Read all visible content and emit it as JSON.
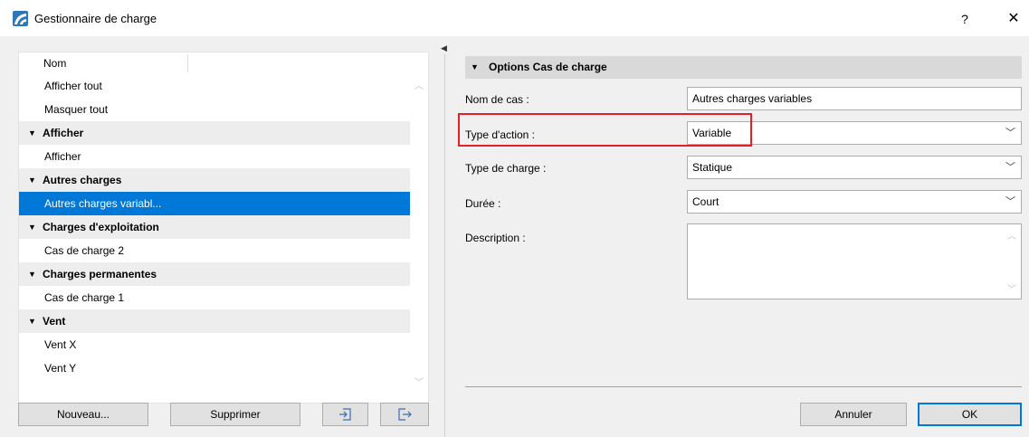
{
  "window": {
    "title": "Gestionnaire de charge",
    "help_label": "?",
    "close_label": "✕"
  },
  "tree": {
    "column_header": "Nom",
    "rows": [
      {
        "label": "Afficher tout",
        "kind": "item"
      },
      {
        "label": "Masquer tout",
        "kind": "item"
      },
      {
        "label": "Afficher",
        "kind": "group"
      },
      {
        "label": "Afficher",
        "kind": "item"
      },
      {
        "label": "Autres charges",
        "kind": "group"
      },
      {
        "label": "Autres charges variabl...",
        "kind": "selected"
      },
      {
        "label": "Charges d'exploitation",
        "kind": "group"
      },
      {
        "label": "Cas de charge 2",
        "kind": "item"
      },
      {
        "label": "Charges permanentes",
        "kind": "group"
      },
      {
        "label": "Cas de charge 1",
        "kind": "item"
      },
      {
        "label": "Vent",
        "kind": "group"
      },
      {
        "label": "Vent X",
        "kind": "item"
      },
      {
        "label": "Vent Y",
        "kind": "item"
      }
    ]
  },
  "left_buttons": {
    "new_label": "Nouveau...",
    "delete_label": "Supprimer"
  },
  "options": {
    "section_title": "Options Cas de charge",
    "case_name": {
      "label": "Nom de cas :",
      "value": "Autres charges variables"
    },
    "action_type": {
      "label": "Type d'action :",
      "value": "Variable"
    },
    "load_type": {
      "label": "Type de charge :",
      "value": "Statique"
    },
    "duration": {
      "label": "Durée :",
      "value": "Court"
    },
    "description": {
      "label": "Description :",
      "value": ""
    }
  },
  "footer": {
    "cancel_label": "Annuler",
    "ok_label": "OK"
  },
  "colors": {
    "selection": "#0078d7",
    "highlight_box": "#e41f26",
    "app_icon": "#2e78b8"
  }
}
